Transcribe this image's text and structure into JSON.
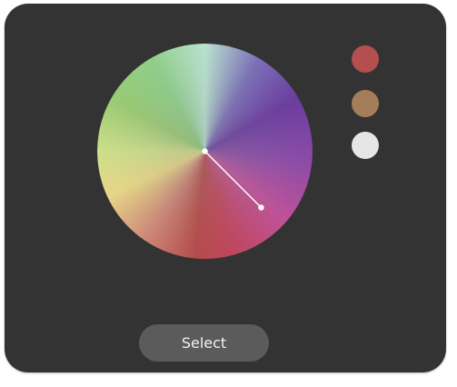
{
  "wheel": {
    "hue_stops": [
      {
        "color": "#b9e3d0",
        "deg": 0
      },
      {
        "color": "#7b6fb8",
        "deg": 30
      },
      {
        "color": "#6a3aa0",
        "deg": 60
      },
      {
        "color": "#8a4aa8",
        "deg": 95
      },
      {
        "color": "#c0509a",
        "deg": 130
      },
      {
        "color": "#c0455a",
        "deg": 165
      },
      {
        "color": "#b54a4a",
        "deg": 185
      },
      {
        "color": "#cf8a78",
        "deg": 215
      },
      {
        "color": "#e9d888",
        "deg": 245
      },
      {
        "color": "#cfe08a",
        "deg": 270
      },
      {
        "color": "#9acb73",
        "deg": 300
      },
      {
        "color": "#8fd08a",
        "deg": 330
      },
      {
        "color": "#b9e3d0",
        "deg": 360
      }
    ],
    "handle": {
      "direction_deg": 135,
      "radius_fraction": 0.74,
      "line_color": "#ffffff"
    }
  },
  "swatches": [
    {
      "name": "swatch-red",
      "color": "#b34f4f"
    },
    {
      "name": "swatch-tan",
      "color": "#a47d5a"
    },
    {
      "name": "swatch-white",
      "color": "#e6e6e6"
    }
  ],
  "select_button": {
    "label": "Select"
  }
}
